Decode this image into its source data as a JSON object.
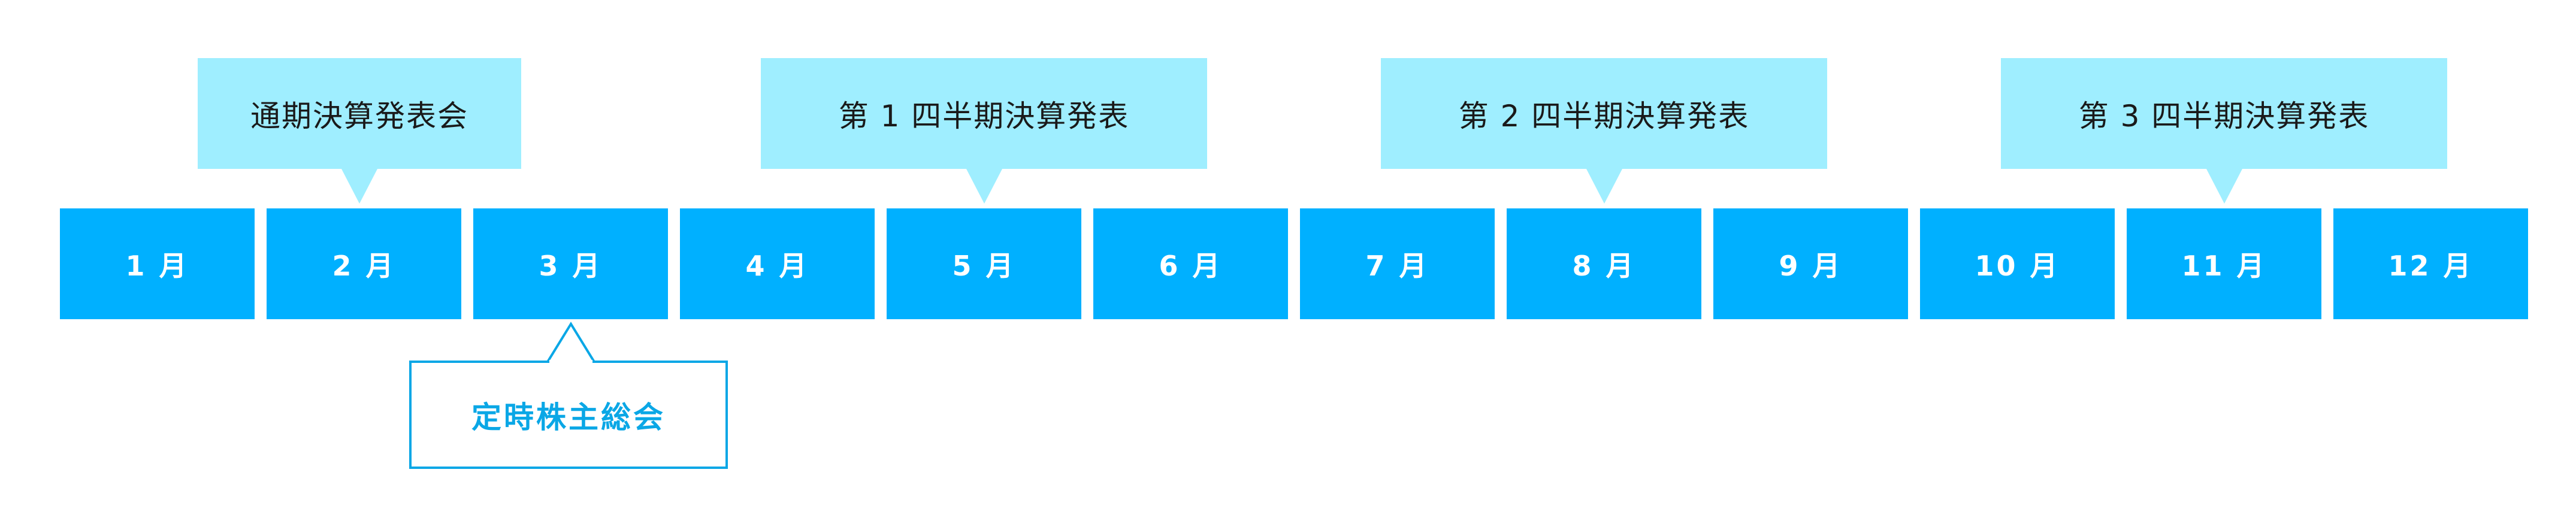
{
  "months": [
    "1 月",
    "2 月",
    "3 月",
    "4 月",
    "5 月",
    "6 月",
    "7 月",
    "8 月",
    "9 月",
    "10 月",
    "11 月",
    "12 月"
  ],
  "events_above": [
    {
      "label": "通期決算発表会",
      "month_index": 1
    },
    {
      "label": "第 1 四半期決算発表",
      "month_index": 4
    },
    {
      "label": "第 2 四半期決算発表",
      "month_index": 7
    },
    {
      "label": "第 3 四半期決算発表",
      "month_index": 10
    }
  ],
  "event_below": {
    "label": "定時株主総会",
    "month_index": 2
  },
  "colors": {
    "month_box": "#00b0ff",
    "callout_fill": "#9feeff",
    "outline_accent": "#0aa7e6"
  }
}
